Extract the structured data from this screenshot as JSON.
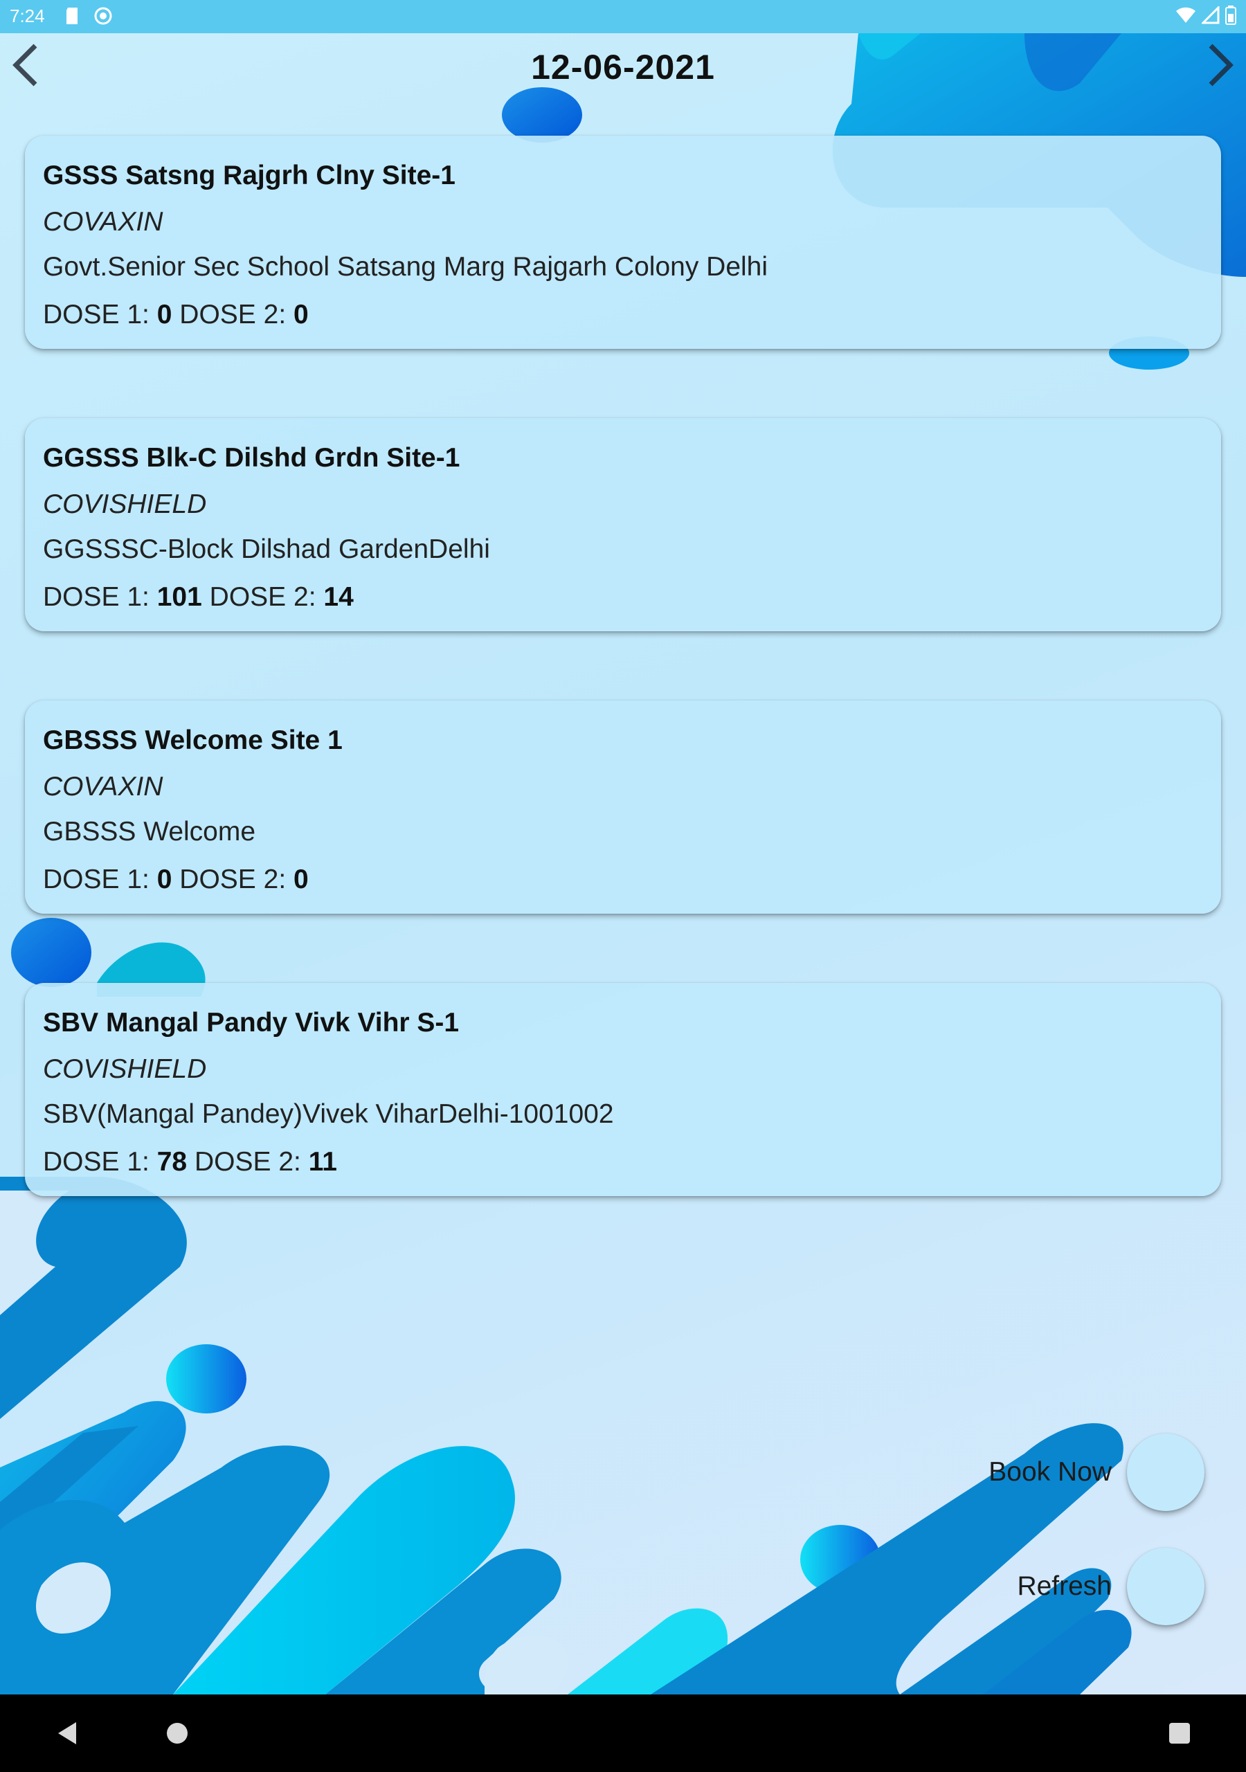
{
  "status_bar": {
    "time": "7:24",
    "icons_left": [
      "sd-card-icon",
      "sync-icon"
    ],
    "icons_right": [
      "wifi-icon",
      "signal-icon",
      "battery-icon"
    ]
  },
  "header": {
    "date": "12-06-2021",
    "prev_icon": "chevron-left-icon",
    "next_icon": "chevron-right-icon"
  },
  "centers": [
    {
      "name": "GSSS Satsng Rajgrh Clny Site-1",
      "vaccine": "COVAXIN",
      "address": "Govt.Senior Sec School Satsang Marg Rajgarh Colony Delhi",
      "dose1_label": "DOSE 1:",
      "dose1": "0",
      "dose2_label": "DOSE 2:",
      "dose2": "0"
    },
    {
      "name": "GGSSS Blk-C Dilshd Grdn Site-1",
      "vaccine": "COVISHIELD",
      "address": "GGSSSC-Block Dilshad GardenDelhi",
      "dose1_label": "DOSE 1:",
      "dose1": "101",
      "dose2_label": "DOSE 2:",
      "dose2": "14"
    },
    {
      "name": "GBSSS Welcome Site 1",
      "vaccine": "COVAXIN",
      "address": "GBSSS Welcome",
      "dose1_label": "DOSE 1:",
      "dose1": "0",
      "dose2_label": "DOSE 2:",
      "dose2": "0"
    },
    {
      "name": "SBV Mangal Pandy Vivk Vihr S-1",
      "vaccine": "COVISHIELD",
      "address": "SBV(Mangal Pandey)Vivek ViharDelhi-1001002",
      "dose1_label": "DOSE 1:",
      "dose1": "78",
      "dose2_label": "DOSE 2:",
      "dose2": "11"
    }
  ],
  "actions": {
    "book_now_label": "Book Now",
    "refresh_label": "Refresh"
  },
  "colors": {
    "background": "#c9eefc",
    "card": "#bee8fc",
    "wave_dark": "#0a7fd0",
    "wave_cyan": "#00c6f0",
    "nav_bar": "#000000"
  },
  "nav_bar": {
    "back_icon": "nav-back-icon",
    "home_icon": "nav-home-icon",
    "recents_icon": "nav-recents-icon"
  }
}
